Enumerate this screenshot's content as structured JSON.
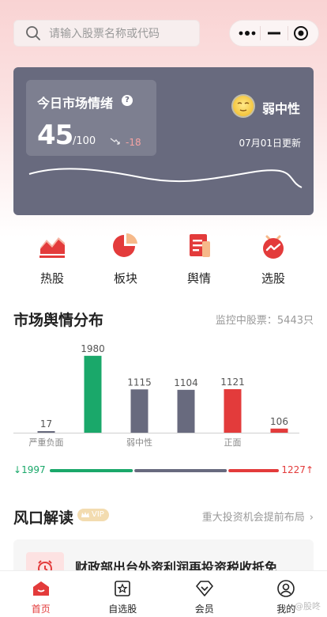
{
  "header": {
    "search_placeholder": "请输入股票名称或代码"
  },
  "sentiment": {
    "title": "今日市场情绪",
    "help": "?",
    "score": "45",
    "score_max": "/100",
    "delta": "-18",
    "mood": "弱中性",
    "updated": "07月01日更新"
  },
  "quick_nav": [
    {
      "label": "热股",
      "icon": "hot-chart-icon"
    },
    {
      "label": "板块",
      "icon": "pie-chart-icon"
    },
    {
      "label": "舆情",
      "icon": "news-doc-icon"
    },
    {
      "label": "选股",
      "icon": "select-stock-icon"
    }
  ],
  "distribution": {
    "title": "市场舆情分布",
    "monitor": "监控中股票：5443只"
  },
  "chart_data": {
    "type": "bar",
    "categories": [
      "严重负面",
      "",
      "弱中性",
      "",
      "正面",
      ""
    ],
    "values": [
      17,
      1980,
      1115,
      1104,
      1121,
      106
    ],
    "colors": [
      "#686a7e",
      "#1aa86a",
      "#686a7e",
      "#686a7e",
      "#e33b3b",
      "#e33b3b"
    ],
    "value_labels": [
      "17",
      "1980",
      "1115",
      "1104",
      "1121",
      "106"
    ],
    "ylim": [
      0,
      2200
    ],
    "grid": false,
    "legend_low": "1997",
    "legend_high": "1227",
    "split": {
      "negative": 1997,
      "neutral": 2219,
      "positive": 1227
    }
  },
  "fengkou": {
    "title": "风口解读",
    "vip": "VIP",
    "more": "重大投资机会提前布局",
    "headline": "财政部出台外资利润再投资税收抵免"
  },
  "tabbar": [
    {
      "label": "首页",
      "active": true
    },
    {
      "label": "自选股",
      "active": false
    },
    {
      "label": "会员",
      "active": false
    },
    {
      "label": "我的",
      "active": false
    }
  ],
  "colors": {
    "accent": "#e33b3b",
    "green": "#1aa86a",
    "card": "#686a7e"
  },
  "watermark": "@股咚"
}
